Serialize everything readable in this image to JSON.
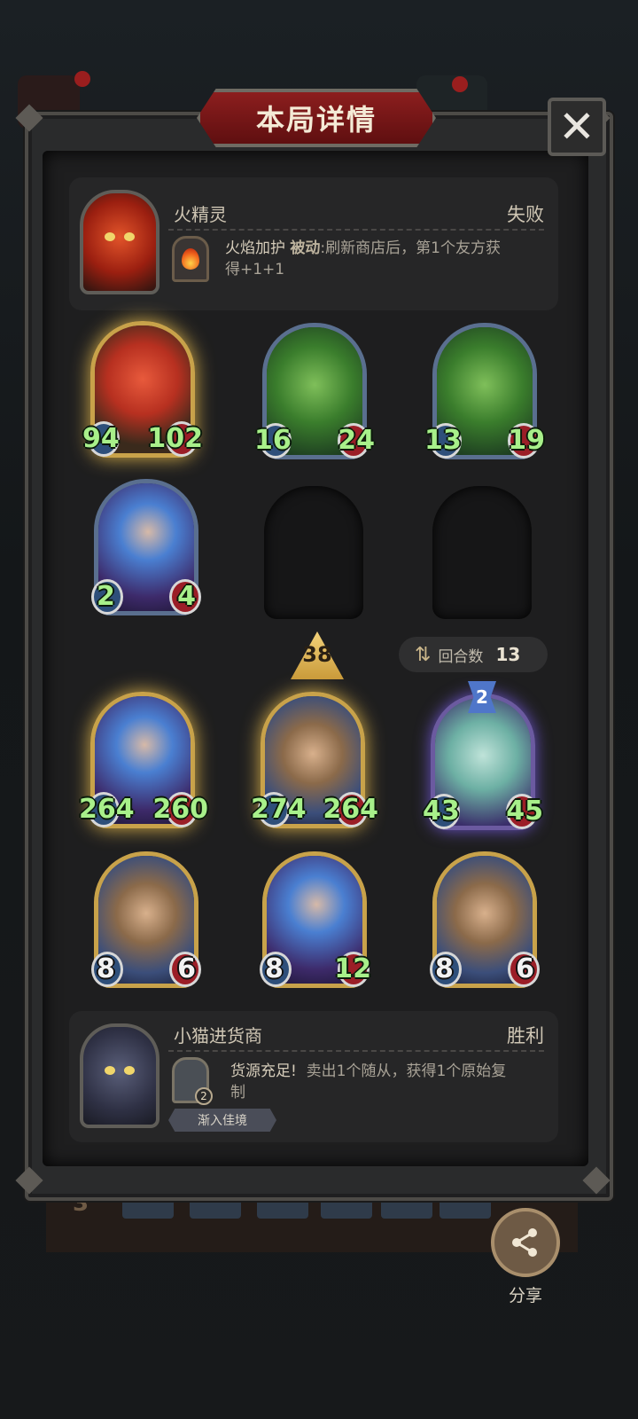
{
  "title": "本局详情",
  "close_glyph": "✕",
  "opponent": {
    "name": "火精灵",
    "result": "失败",
    "skill_name": "火焰加护",
    "skill_type": "被动",
    "skill_desc_line1": ":刷新商店后，第1个友方获",
    "skill_desc_line2": "得+1+1",
    "skill_icon": "flame-icon"
  },
  "opponent_board": [
    {
      "attack": "94",
      "health": "102",
      "art": "imp"
    },
    {
      "attack": "16",
      "health": "24",
      "art": "dryad"
    },
    {
      "attack": "13",
      "health": "19",
      "art": "dryad"
    },
    {
      "attack": "2",
      "health": "4",
      "art": "sorceress"
    }
  ],
  "tier": "38",
  "rounds": {
    "label": "回合数",
    "value": "13",
    "icon": "swap-icon"
  },
  "player_board": [
    {
      "attack": "264",
      "health": "260",
      "art": "sorceress"
    },
    {
      "attack": "274",
      "health": "264",
      "art": "king"
    },
    {
      "attack": "43",
      "health": "45",
      "art": "horse",
      "star": "2"
    },
    {
      "attack": "8",
      "health": "6",
      "art": "king"
    },
    {
      "attack": "8",
      "health": "12",
      "art": "sorceress"
    },
    {
      "attack": "8",
      "health": "6",
      "art": "king"
    }
  ],
  "player": {
    "name": "小猫进货商",
    "result": "胜利",
    "skill_title": "货源充足!",
    "skill_desc_line1": "卖出1个随从，获得1个原始复",
    "skill_desc_line2": "制",
    "item_count": "2",
    "tag": "渐入佳境"
  },
  "share": {
    "label": "分享",
    "icon": "share-icon"
  },
  "background_strip_value": "3",
  "colors": {
    "gold_frame": "#c8a24a",
    "stat_green": "#a8f08a",
    "title_red": "#8c1e1e"
  }
}
